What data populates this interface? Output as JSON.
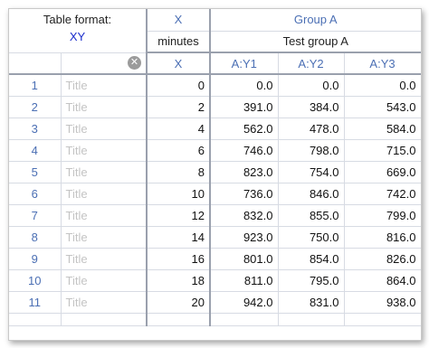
{
  "table_format": {
    "label": "Table format:",
    "value": "XY"
  },
  "x_column": {
    "header": "X",
    "title": "minutes",
    "subheader": "X"
  },
  "group": {
    "header": "Group A",
    "title": "Test group A",
    "subheaders": [
      "A:Y1",
      "A:Y2",
      "A:Y3"
    ]
  },
  "clear_icon": "clear-circle-x-icon",
  "rows": [
    {
      "num": "1",
      "title": "Title",
      "x": "0",
      "y1": "0.0",
      "y2": "0.0",
      "y3": "0.0"
    },
    {
      "num": "2",
      "title": "Title",
      "x": "2",
      "y1": "391.0",
      "y2": "384.0",
      "y3": "543.0"
    },
    {
      "num": "3",
      "title": "Title",
      "x": "4",
      "y1": "562.0",
      "y2": "478.0",
      "y3": "584.0"
    },
    {
      "num": "4",
      "title": "Title",
      "x": "6",
      "y1": "746.0",
      "y2": "798.0",
      "y3": "715.0"
    },
    {
      "num": "5",
      "title": "Title",
      "x": "8",
      "y1": "823.0",
      "y2": "754.0",
      "y3": "669.0"
    },
    {
      "num": "6",
      "title": "Title",
      "x": "10",
      "y1": "736.0",
      "y2": "846.0",
      "y3": "742.0"
    },
    {
      "num": "7",
      "title": "Title",
      "x": "12",
      "y1": "832.0",
      "y2": "855.0",
      "y3": "799.0"
    },
    {
      "num": "8",
      "title": "Title",
      "x": "14",
      "y1": "923.0",
      "y2": "750.0",
      "y3": "816.0"
    },
    {
      "num": "9",
      "title": "Title",
      "x": "16",
      "y1": "801.0",
      "y2": "854.0",
      "y3": "826.0"
    },
    {
      "num": "10",
      "title": "Title",
      "x": "18",
      "y1": "811.0",
      "y2": "795.0",
      "y3": "864.0"
    },
    {
      "num": "11",
      "title": "Title",
      "x": "20",
      "y1": "942.0",
      "y2": "831.0",
      "y3": "938.0"
    }
  ]
}
